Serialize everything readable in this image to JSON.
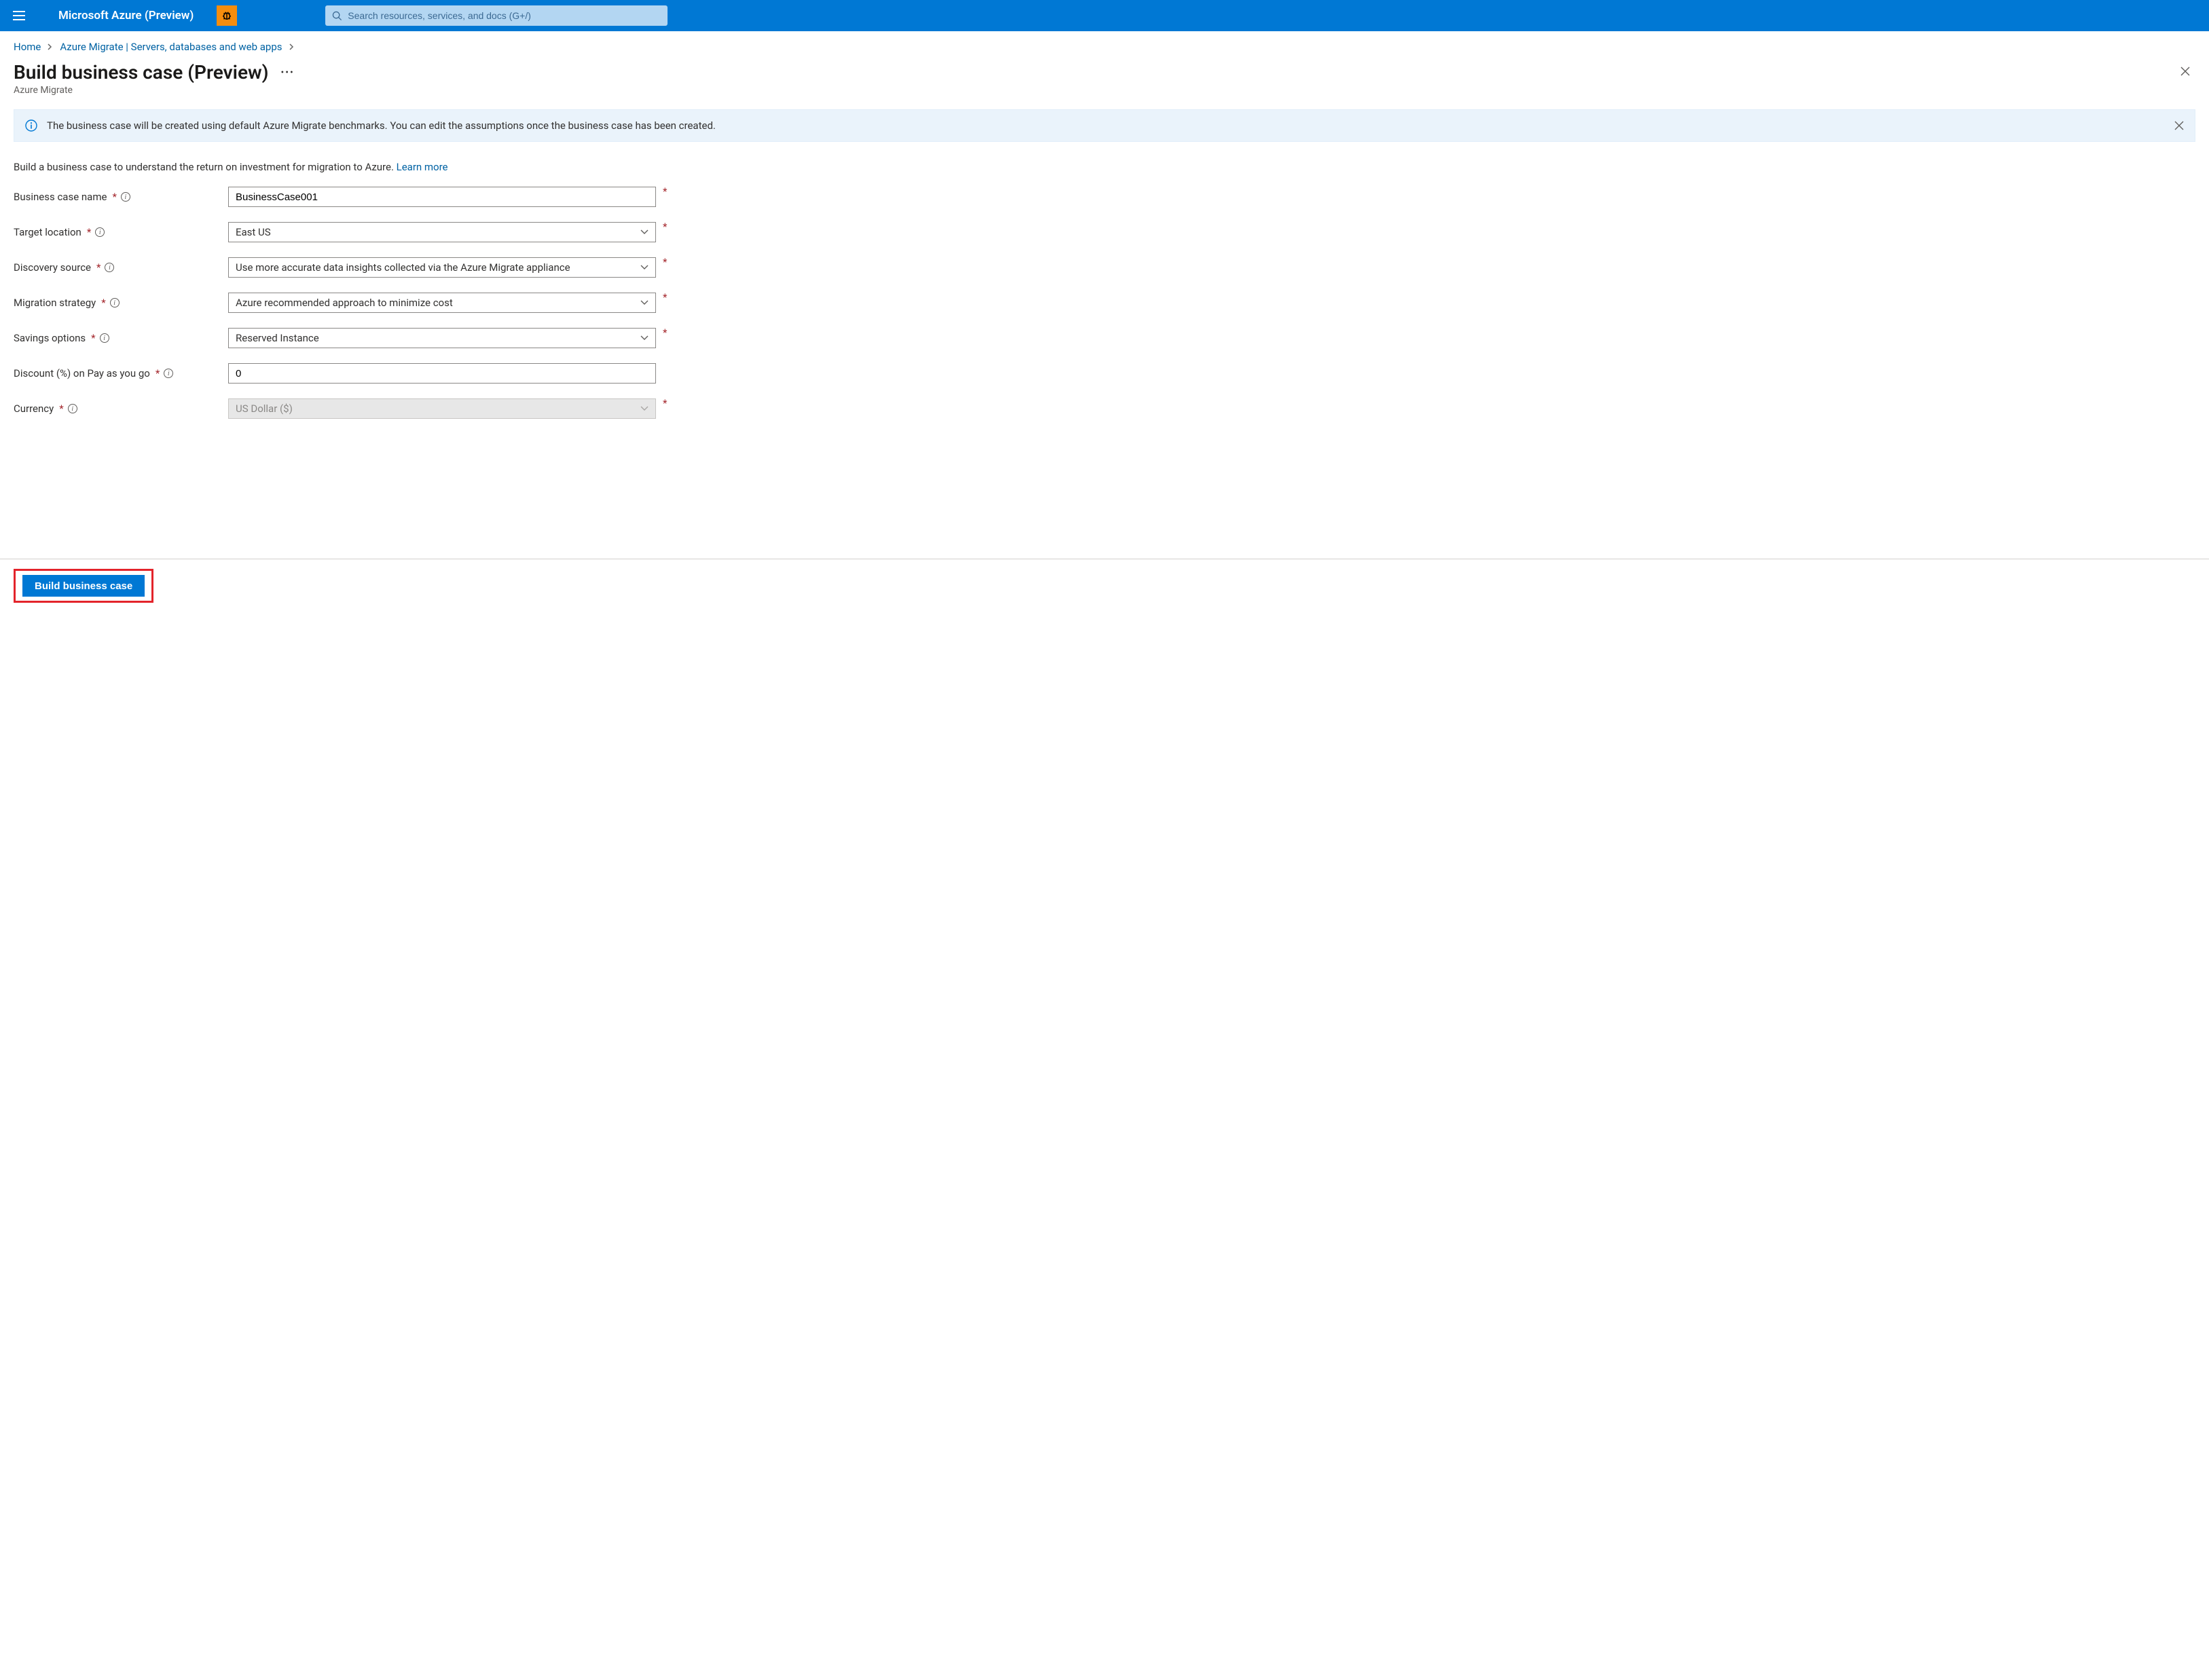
{
  "header": {
    "brand": "Microsoft Azure (Preview)",
    "search_placeholder": "Search resources, services, and docs (G+/)"
  },
  "breadcrumb": {
    "home": "Home",
    "migrate": "Azure Migrate | Servers, databases and web apps"
  },
  "page": {
    "title": "Build business case (Preview)",
    "subtitle": "Azure Migrate",
    "banner": "The business case will be created using default Azure Migrate benchmarks. You can edit the assumptions once the business case has been created.",
    "intro_text": "Build a business case to understand the return on investment for migration to Azure. ",
    "learn_more": "Learn more"
  },
  "form": {
    "name_label": "Business case name",
    "name_value": "BusinessCase001",
    "target_label": "Target location",
    "target_value": "East US",
    "discovery_label": "Discovery source",
    "discovery_value": "Use more accurate data insights collected via the Azure Migrate appliance",
    "strategy_label": "Migration strategy",
    "strategy_value": "Azure recommended approach to minimize cost",
    "savings_label": "Savings options",
    "savings_value": "Reserved Instance",
    "discount_label": "Discount (%) on Pay as you go",
    "discount_value": "0",
    "currency_label": "Currency",
    "currency_value": "US Dollar ($)"
  },
  "footer": {
    "build_label": "Build business case"
  }
}
